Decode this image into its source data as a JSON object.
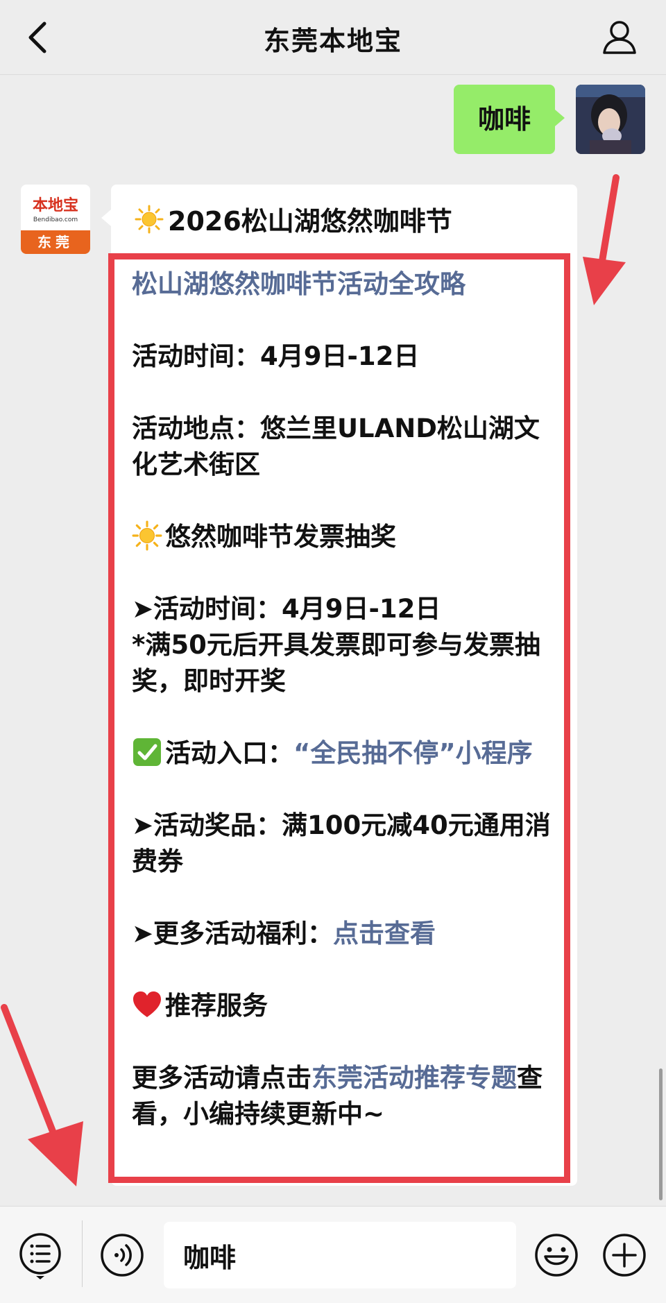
{
  "header": {
    "title": "东莞本地宝",
    "back_icon": "chevron-left-icon",
    "profile_icon": "person-icon"
  },
  "outgoing_message": {
    "text": "咖啡",
    "bubble_color": "#95ec69"
  },
  "bot_avatar": {
    "logo_text": "本地宝",
    "logo_sub": "Bendibao.com",
    "city": "东莞"
  },
  "incoming_message": {
    "header": "2026松山湖悠然咖啡节",
    "header_icon": "sun-icon",
    "link_title": "松山湖悠然咖啡节活动全攻略",
    "time_line": "活动时间：4月9日-12日",
    "place_line": "活动地点：悠兰里ULAND松山湖文化艺术街区",
    "section2_title": "悠然咖啡节发票抽奖",
    "section2_icon": "sun-icon",
    "lottery_time": "➤活动时间：4月9日-12日",
    "lottery_rule": "*满50元后开具发票即可参与发票抽奖，即时开奖",
    "entry_icon": "check-mark-icon",
    "entry_label": "活动入口：",
    "entry_link": "“全民抽不停”小程序",
    "prize_line": "➤活动奖品：满100元减40元通用消费券",
    "more_label": "➤更多活动福利：",
    "more_link": "点击查看",
    "section3_icon": "heart-icon",
    "section3_title": "推荐服务",
    "footer_prefix": "更多活动请点击",
    "footer_link": "东莞活动推荐专题",
    "footer_suffix": "查看，小编持续更新中~"
  },
  "input_bar": {
    "value": "咖啡",
    "menu_icon": "menu-list-icon",
    "voice_icon": "voice-icon",
    "emoji_icon": "smiley-icon",
    "plus_icon": "plus-icon"
  },
  "colors": {
    "link": "#576b95",
    "highlight_frame": "#e84049",
    "background": "#ededed"
  }
}
